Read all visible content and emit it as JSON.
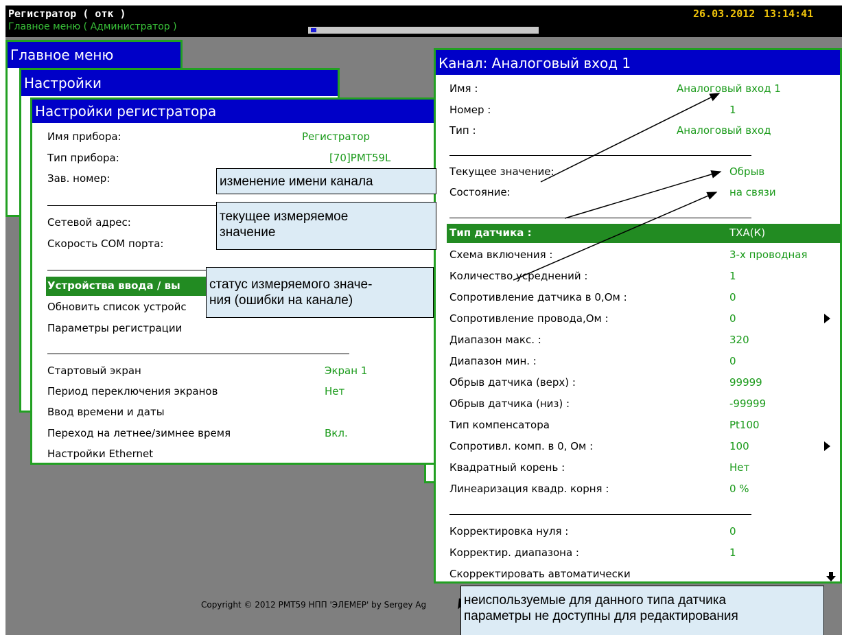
{
  "topbar": {
    "title": "Регистратор ( отк )",
    "subtitle": "Главное меню ( Администратор )",
    "date": "26.03.2012",
    "time": "13:14:41"
  },
  "main_menu": {
    "title": "Главное меню"
  },
  "settings": {
    "title": "Настройки"
  },
  "registrar_settings": {
    "title": "Настройки регистратора",
    "device_name_label": "Имя прибора:",
    "device_name_value": "Регистратор",
    "device_type_label": "Тип прибора:",
    "device_type_value": "[70]PMT59L",
    "serial_label": "Зав. номер:",
    "net_address_label": "Сетевой адрес:",
    "com_speed_label": "Скорость COM порта:",
    "io_devices_label": "Устройства ввода / вы",
    "update_devices_label": "Обновить список устройс",
    "reg_params_label": "Параметры регистрации",
    "start_screen_label": "Стартовый экран",
    "start_screen_value": "Экран 1",
    "switch_period_label": "Период переключения экранов",
    "switch_period_value": "Нет",
    "datetime_label": "Ввод времени и даты",
    "dst_label": "Переход на летнее/зимнее время",
    "dst_value": "Вкл.",
    "ethernet_label": "Настройки Ethernet"
  },
  "channel": {
    "title": "Канал: Аналоговый вход 1",
    "name_label": "Имя :",
    "name_value": "Аналоговый вход 1",
    "number_label": "Номер :",
    "number_value": "1",
    "type_label": "Тип :",
    "type_value": "Аналоговый вход",
    "current_label": "Текущее значение:",
    "current_value": "Обрыв",
    "state_label": "Состояние:",
    "state_value": "на связи",
    "sensor_type_label": "Тип датчика :",
    "sensor_type_value": "ТХА(К)",
    "scheme_label": "Схема включения :",
    "scheme_value": "3-х проводная",
    "avg_label": "Количество усреднений :",
    "avg_value": "1",
    "sensor_res_label": "Сопротивление датчика в 0,Ом :",
    "sensor_res_value": "0",
    "wire_res_label": "Сопротивление провода,Ом :",
    "wire_res_value": "0",
    "range_max_label": "Диапазон макс. :",
    "range_max_value": "320",
    "range_min_label": "Диапазон мин. :",
    "range_min_value": "0",
    "break_high_label": "Обрыв датчика (верх) :",
    "break_high_value": "99999",
    "break_low_label": "Обрыв датчика (низ) :",
    "break_low_value": "-99999",
    "comp_type_label": "Тип компенсатора",
    "comp_type_value": "Pt100",
    "comp_res_label": "Сопротивл. комп. в 0, Ом :",
    "comp_res_value": "100",
    "sqrt_label": "Квадратный корень :",
    "sqrt_value": "Нет",
    "sqrt_lin_label": "Линеаризация квадр. корня :",
    "sqrt_lin_value": "0 %",
    "zero_corr_label": "Корректировка нуля :",
    "zero_corr_value": "0",
    "range_corr_label": "Корректир. диапазона :",
    "range_corr_value": "1",
    "auto_corr_label": "Скорректировать автоматически"
  },
  "callouts": {
    "rename": "изменение имени канала",
    "measured_1": "текущее измеряемое",
    "measured_2": "значение",
    "status_1": "статус измеряемого значе-",
    "status_2": "ния (ошибки на канале)",
    "unused_1": "неиспользуемые для данного типа датчика",
    "unused_2": "параметры не доступны для редактирования"
  },
  "copyright": "Copyright © 2012 PMT59 НПП 'ЭЛЕМЕР' by Sergey Ag"
}
